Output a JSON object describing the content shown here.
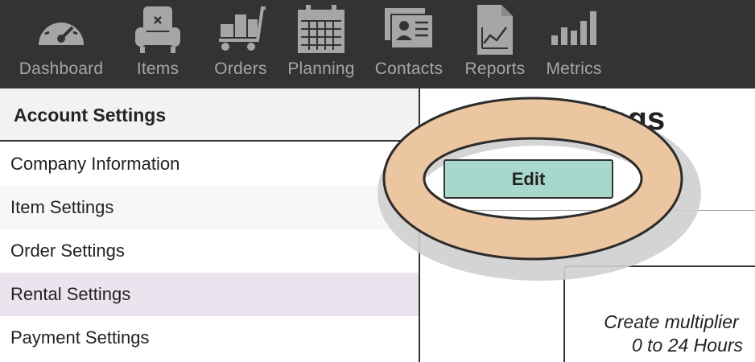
{
  "nav": {
    "items": [
      {
        "label": "Dashboard",
        "icon": "gauge-icon"
      },
      {
        "label": "Items",
        "icon": "armchair-icon"
      },
      {
        "label": "Orders",
        "icon": "cart-icon"
      },
      {
        "label": "Planning",
        "icon": "calendar-icon"
      },
      {
        "label": "Contacts",
        "icon": "contact-card-icon"
      },
      {
        "label": "Reports",
        "icon": "report-chart-icon"
      },
      {
        "label": "Metrics",
        "icon": "bar-chart-icon"
      }
    ]
  },
  "sidebar": {
    "header": "Account Settings",
    "items": [
      {
        "label": "Company Information"
      },
      {
        "label": "Item Settings"
      },
      {
        "label": "Order Settings"
      },
      {
        "label": "Rental Settings"
      },
      {
        "label": "Payment Settings"
      }
    ]
  },
  "main": {
    "title_partial": "ings",
    "edit_label": "Edit",
    "card_line1": "Create multiplier",
    "card_line2": "0 to 24 Hours"
  },
  "colors": {
    "nav_bg": "#333333",
    "nav_text": "#a6a6a6",
    "sidebar_header_bg": "#f2f2f2",
    "sidebar_alt_bg": "#f7f7f7",
    "sidebar_selected_bg": "#ebe4ee",
    "edit_button_bg": "#a8d8cc",
    "highlight_ring": "#ebc6a1"
  }
}
